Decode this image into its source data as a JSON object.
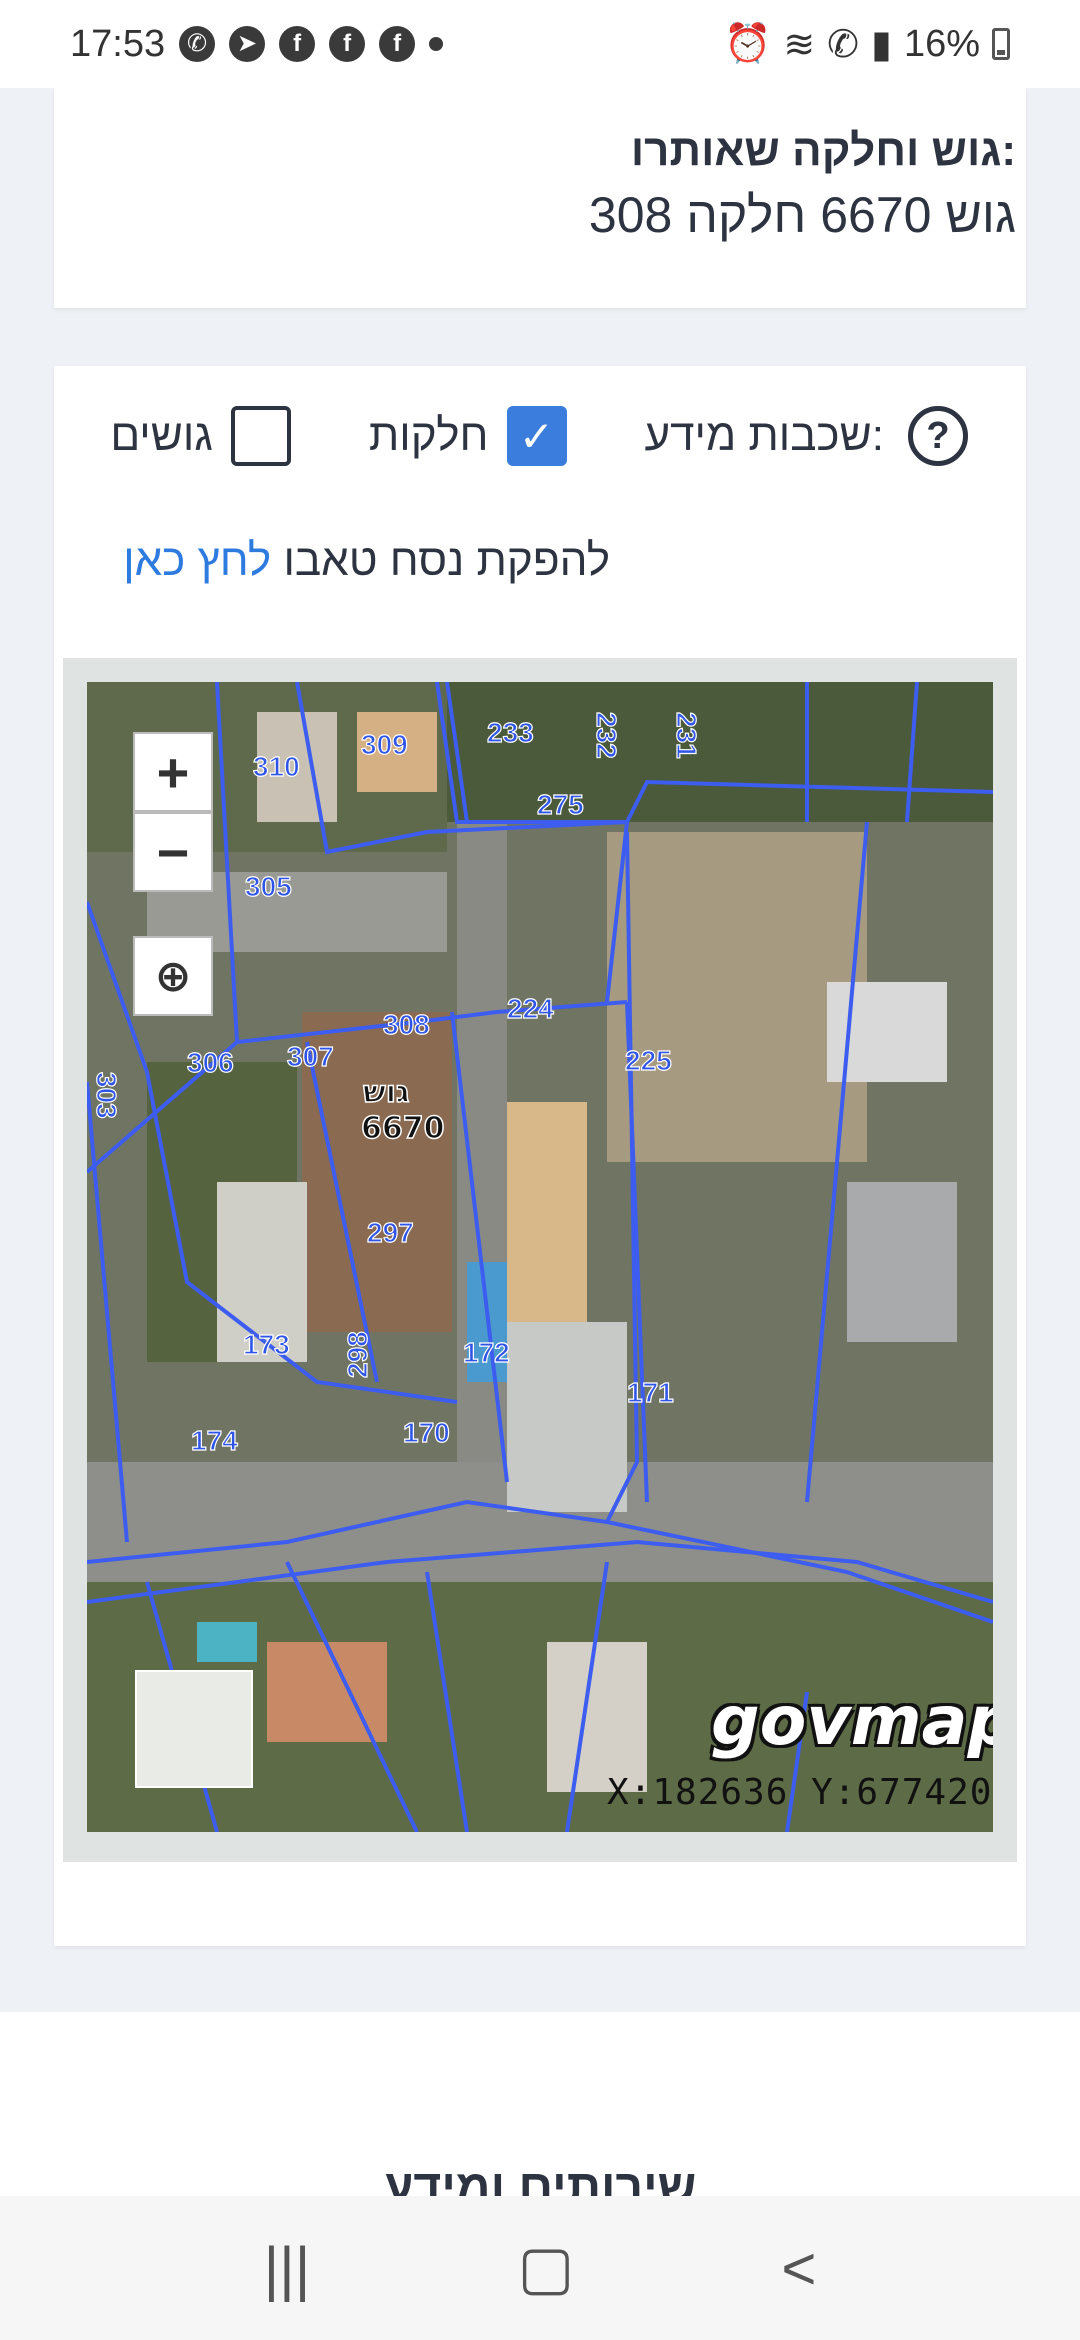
{
  "status_bar": {
    "time": "17:53",
    "battery": "16%",
    "left_icons": [
      "whatsapp-icon",
      "telegram-icon",
      "facebook-icon",
      "facebook-icon",
      "facebook-icon",
      "dot-icon"
    ],
    "right_icons": [
      "alarm-icon",
      "wifi-icon",
      "call-icon",
      "signal-icon",
      "battery-icon"
    ]
  },
  "parcel_card": {
    "title": "גוש וחלקה שאותרו:",
    "value": "גוש 6670 חלקה 308"
  },
  "layers": {
    "label": "שכבות מידע:",
    "options": [
      {
        "label": "חלקות",
        "checked": true
      },
      {
        "label": "גושים",
        "checked": false
      }
    ]
  },
  "tabu": {
    "text": "להפקת נסח טאבו",
    "link": "לחץ כאן"
  },
  "map": {
    "logo": "govmap",
    "coordinates": "X:182636 Y:677420",
    "zoom_in": "+",
    "zoom_out": "−",
    "block_label": "גוש",
    "block_number": "6670",
    "parcels": [
      "233",
      "232",
      "231",
      "309",
      "310",
      "275",
      "305",
      "224",
      "308",
      "306",
      "307",
      "225",
      "303",
      "297",
      "173",
      "298",
      "172",
      "174",
      "170",
      "171"
    ]
  },
  "footer": {
    "heading": "שירותים ומידע"
  },
  "nav": {
    "recents": "|||",
    "home": "▢",
    "back": "<"
  }
}
